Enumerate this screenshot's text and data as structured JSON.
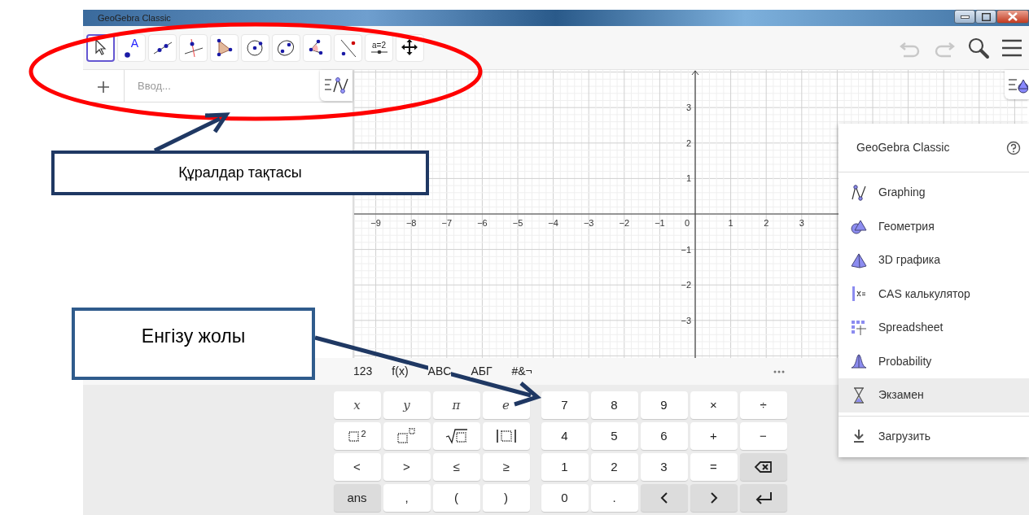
{
  "window": {
    "title": "GeoGebra Classic"
  },
  "toolbar": {
    "tools": [
      {
        "kind": "move",
        "selected": true
      },
      {
        "kind": "point",
        "selected": false,
        "label": "A"
      },
      {
        "kind": "line",
        "selected": false
      },
      {
        "kind": "perpendicular",
        "selected": false
      },
      {
        "kind": "polygon",
        "selected": false
      },
      {
        "kind": "circle",
        "selected": false
      },
      {
        "kind": "conic",
        "selected": false
      },
      {
        "kind": "angle",
        "selected": false
      },
      {
        "kind": "reflect",
        "selected": false
      },
      {
        "kind": "slider",
        "selected": false,
        "label": "a=2"
      },
      {
        "kind": "pan",
        "selected": false
      }
    ],
    "undo_disabled": true,
    "redo_disabled": true
  },
  "algebra": {
    "input": {
      "placeholder": "Ввод..."
    }
  },
  "graphics": {
    "x_labels": [
      "−9",
      "−8",
      "−7",
      "−6",
      "−5",
      "−4",
      "−3",
      "−2",
      "−1",
      "1",
      "2",
      "3"
    ],
    "origin_label": "0",
    "y_labels": [
      "3",
      "2",
      "1",
      "−1",
      "−2",
      "−3"
    ]
  },
  "keyboard": {
    "tabs": [
      {
        "label": "123"
      },
      {
        "label": "f(x)"
      },
      {
        "label": "ABC"
      },
      {
        "label": "АБГ"
      },
      {
        "label": "#&¬"
      }
    ],
    "left_keys": [
      [
        {
          "kind": "var",
          "label": "x"
        },
        {
          "kind": "var",
          "label": "y"
        },
        {
          "kind": "var",
          "label": "π"
        },
        {
          "kind": "var",
          "label": "e"
        }
      ],
      [
        {
          "kind": "squared",
          "label": "2"
        },
        {
          "kind": "power"
        },
        {
          "kind": "sqrt"
        },
        {
          "kind": "abs"
        }
      ],
      [
        {
          "kind": "text",
          "label": "<"
        },
        {
          "kind": "text",
          "label": ">"
        },
        {
          "kind": "text",
          "label": "≤"
        },
        {
          "kind": "text",
          "label": "≥"
        }
      ],
      [
        {
          "kind": "grey",
          "label": "ans"
        },
        {
          "kind": "text",
          "label": ","
        },
        {
          "kind": "text",
          "label": "("
        },
        {
          "kind": "text",
          "label": ")"
        }
      ]
    ],
    "right_keys": [
      [
        {
          "kind": "text",
          "label": "7"
        },
        {
          "kind": "text",
          "label": "8"
        },
        {
          "kind": "text",
          "label": "9"
        },
        {
          "kind": "text",
          "label": "×"
        },
        {
          "kind": "text",
          "label": "÷"
        }
      ],
      [
        {
          "kind": "text",
          "label": "4"
        },
        {
          "kind": "text",
          "label": "5"
        },
        {
          "kind": "text",
          "label": "6"
        },
        {
          "kind": "text",
          "label": "+"
        },
        {
          "kind": "text",
          "label": "−"
        }
      ],
      [
        {
          "kind": "text",
          "label": "1"
        },
        {
          "kind": "text",
          "label": "2"
        },
        {
          "kind": "text",
          "label": "3"
        },
        {
          "kind": "text",
          "label": "="
        },
        {
          "kind": "backspace"
        }
      ],
      [
        {
          "kind": "text",
          "label": "0"
        },
        {
          "kind": "text",
          "label": "."
        },
        {
          "kind": "left"
        },
        {
          "kind": "right"
        },
        {
          "kind": "enter"
        }
      ]
    ]
  },
  "menu": {
    "title": "GeoGebra Classic",
    "apps": [
      {
        "kind": "graphing",
        "label": "Graphing",
        "selected": false
      },
      {
        "kind": "geometry",
        "label": "Геометрия",
        "selected": false
      },
      {
        "kind": "solid",
        "label": "3D графика",
        "selected": false
      },
      {
        "kind": "cas",
        "label": "CAS калькулятор",
        "selected": false
      },
      {
        "kind": "spreadsheet",
        "label": "Spreadsheet",
        "selected": false
      },
      {
        "kind": "probability",
        "label": "Probability",
        "selected": false
      },
      {
        "kind": "exam",
        "label": "Экзамен",
        "selected": true
      }
    ],
    "download": {
      "label": "Загрузить"
    }
  },
  "annotations": [
    {
      "text": "Құралдар тақтасы"
    },
    {
      "text": "Енгізу жолы"
    }
  ]
}
